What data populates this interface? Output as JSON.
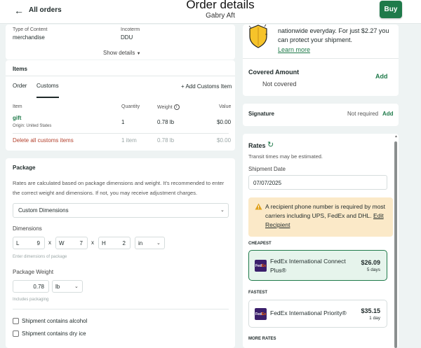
{
  "header": {
    "back_label": "All orders",
    "title": "Order details",
    "subtitle": "Gabry Aft",
    "buy_label": "Buy"
  },
  "content_info": {
    "type_label": "Type of Content",
    "type_value": "merchandise",
    "incoterm_label": "Incoterm",
    "incoterm_value": "DDU",
    "show_details": "Show details"
  },
  "items": {
    "title": "Items",
    "tabs": [
      "Order",
      "Customs"
    ],
    "active_tab": "Customs",
    "add_customs_item": "+ Add Customs Item",
    "columns": {
      "item": "Item",
      "quantity": "Quantity",
      "weight": "Weight",
      "value": "Value"
    },
    "rows": [
      {
        "name": "gift",
        "origin": "Origin: United States",
        "quantity": "1",
        "weight": "0.78 lb",
        "value": "$0.00"
      }
    ],
    "delete_all": "Delete all customs items",
    "total_quantity": "1 item",
    "total_weight": "0.78 lb",
    "total_value": "$0.00"
  },
  "package": {
    "title": "Package",
    "description": "Rates are calculated based on package dimensions and weight. It's recommended to enter the correct weight and dimensions. If not, you may receive adjustment charges.",
    "package_type": "Custom Dimensions",
    "dimensions_label": "Dimensions",
    "length_prefix": "L",
    "length_value": "9",
    "width_prefix": "W",
    "width_value": "7",
    "height_prefix": "H",
    "height_value": "2",
    "separator": "x",
    "unit": "in",
    "dimensions_hint": "Enter dimensions of package",
    "weight_label": "Package Weight",
    "weight_value": "0.78",
    "weight_unit": "lb",
    "weight_hint": "Includes packaging",
    "checkbox_alcohol": "Shipment contains alcohol",
    "checkbox_dry_ice": "Shipment contains dry ice"
  },
  "insurance": {
    "text": "nationwide everyday. For just $2.27 you can protect your shipment.",
    "learn_more": "Learn more",
    "covered_label": "Covered Amount",
    "covered_value": "Not covered",
    "add_label": "Add"
  },
  "signature": {
    "label": "Signature",
    "value": "Not required",
    "add_label": "Add"
  },
  "rates": {
    "title": "Rates",
    "note": "Transit times may be estimated.",
    "shipment_date_label": "Shipment Date",
    "shipment_date": "07/07/2025",
    "alert_text": "A recipient phone number is required by most carriers including UPS, FedEx and DHL.",
    "alert_link": "Edit Recipient",
    "cheapest_label": "CHEAPEST",
    "fastest_label": "FASTEST",
    "more_rates_label": "MORE RATES",
    "options": [
      {
        "carrier": "FedEx International Connect Plus®",
        "price": "$26.09",
        "days": "5 days"
      },
      {
        "carrier": "FedEx International Priority®",
        "price": "$35.15",
        "days": "1 day"
      }
    ],
    "logo_fed": "Fed",
    "logo_ex": "Ex"
  },
  "colors": {
    "accent_green": "#1f7a4a",
    "delete_red": "#b3402c",
    "selected_rate_bg": "#e6f4ec",
    "alert_bg": "#fbe9c8",
    "fedex_purple": "#3b1f6b"
  }
}
